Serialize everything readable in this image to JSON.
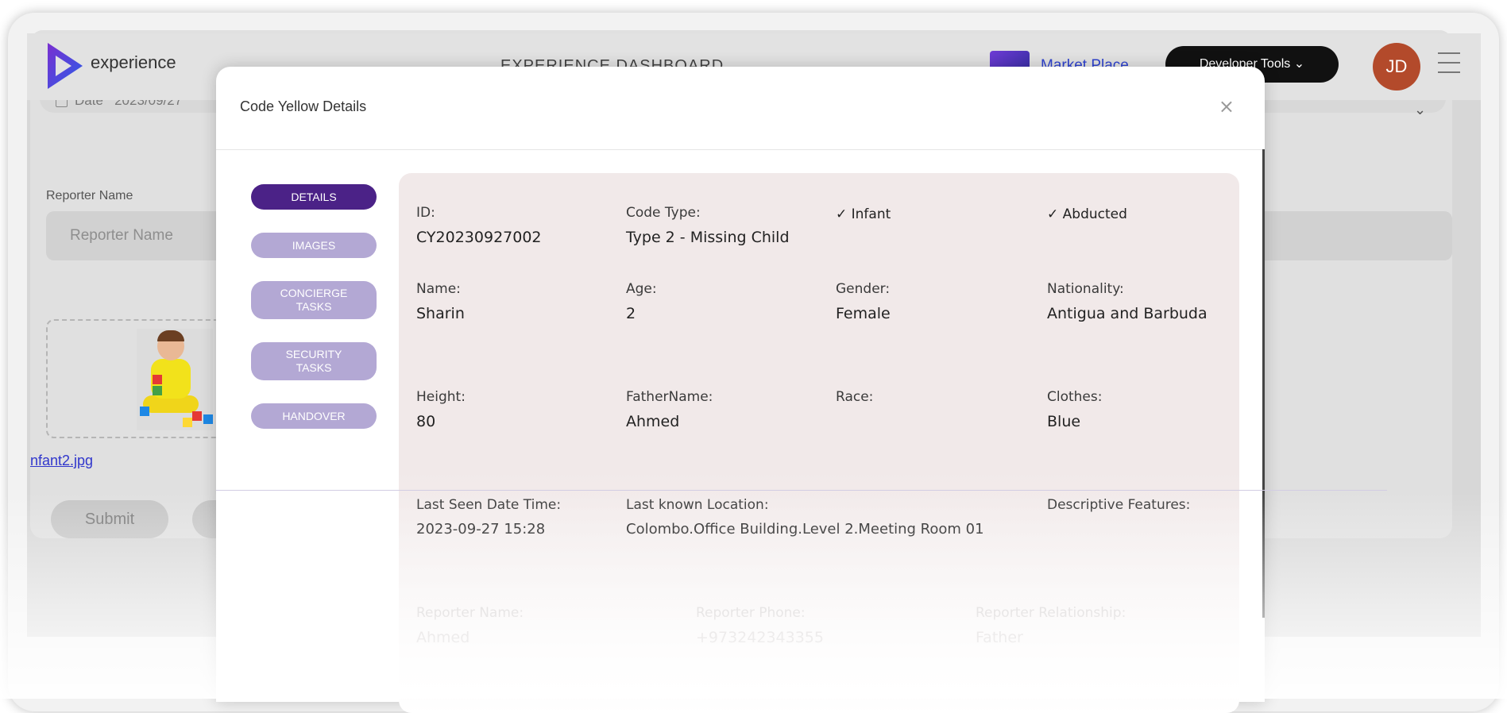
{
  "header": {
    "brand": "experience",
    "dashboard_title": "EXPERIENCE DASHBOARD",
    "market_place": "Market Place",
    "developer_tools": "Developer Tools",
    "avatar_initials": "JD"
  },
  "background_form": {
    "date_label": "Date",
    "date_value": "2023/09/27",
    "reporter_name_label": "Reporter Name",
    "reporter_name_placeholder": "Reporter Name",
    "file_name": "nfant2.jpg",
    "submit_label": "Submit"
  },
  "modal": {
    "title": "Code Yellow Details",
    "close_symbol": "×",
    "tabs": [
      {
        "label": "DETAILS",
        "active": true
      },
      {
        "label": "IMAGES",
        "active": false
      },
      {
        "label": "CONCIERGE TASKS",
        "active": false
      },
      {
        "label": "SECURITY TASKS",
        "active": false
      },
      {
        "label": "HANDOVER",
        "active": false
      }
    ],
    "details": {
      "id_label": "ID:",
      "id_value": "CY20230927002",
      "code_type_label": "Code Type:",
      "code_type_value": "Type 2 - Missing Child",
      "flag_infant": "✓ Infant",
      "flag_abducted": "✓ Abducted",
      "name_label": "Name:",
      "name_value": "Sharin",
      "age_label": "Age:",
      "age_value": "2",
      "gender_label": "Gender:",
      "gender_value": "Female",
      "nationality_label": "Nationality:",
      "nationality_value": "Antigua and Barbuda",
      "height_label": "Height:",
      "height_value": "80",
      "father_label": "FatherName:",
      "father_value": "Ahmed",
      "race_label": "Race:",
      "race_value": "",
      "clothes_label": "Clothes:",
      "clothes_value": "Blue",
      "last_seen_label": "Last Seen Date Time:",
      "last_seen_value": "2023-09-27 15:28",
      "location_label": "Last known Location:",
      "location_value": "Colombo.Office Building.Level 2.Meeting Room 01",
      "features_label": "Descriptive Features:",
      "features_value": "",
      "reporter_name_label": "Reporter Name:",
      "reporter_name_value": "Ahmed",
      "reporter_phone_label": "Reporter Phone:",
      "reporter_phone_value": "+973242343355",
      "reporter_rel_label": "Reporter Relationship:",
      "reporter_rel_value": "Father"
    }
  },
  "colors": {
    "active_tab": "#4b2287",
    "inactive_tab": "#b3a8d4",
    "card_bg": "#f1e9e9",
    "avatar": "#b34a2b",
    "link": "#2e42cf"
  }
}
